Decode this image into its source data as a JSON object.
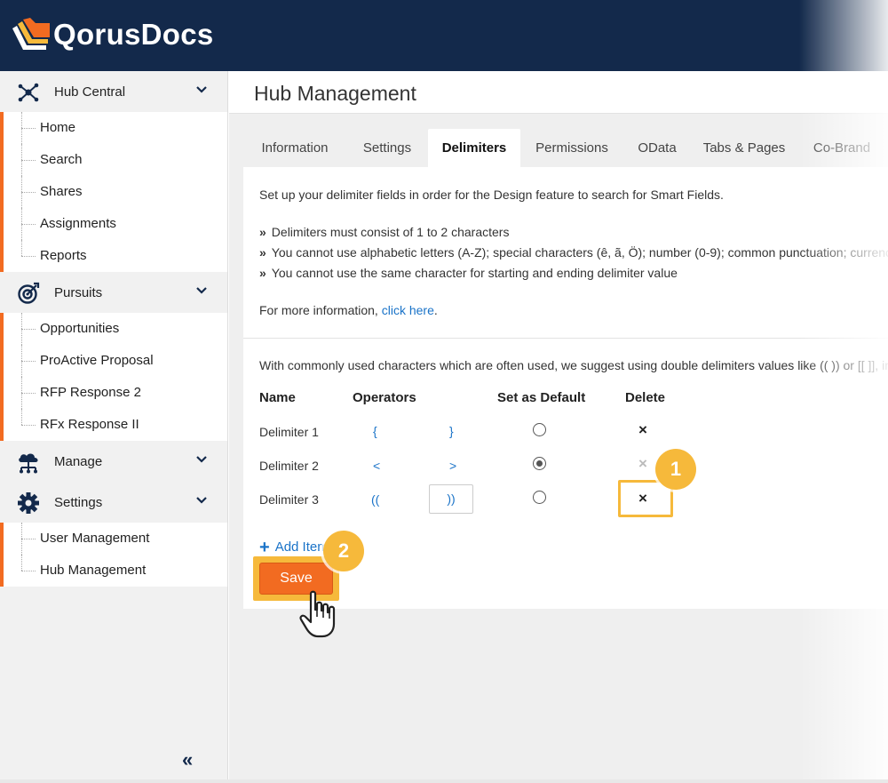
{
  "brand": {
    "name": "QorusDocs",
    "accent": "#f26b21",
    "header_bg": "#13294b",
    "callout": "#f6b93b"
  },
  "sidebar": {
    "groups": [
      {
        "label": "Hub Central",
        "icon": "hub-icon",
        "items": [
          "Home",
          "Search",
          "Shares",
          "Assignments",
          "Reports"
        ]
      },
      {
        "label": "Pursuits",
        "icon": "target-icon",
        "items": [
          "Opportunities",
          "ProActive Proposal",
          "RFP Response 2",
          "RFx Response II"
        ]
      },
      {
        "label": "Manage",
        "icon": "cloud-network-icon",
        "items": []
      },
      {
        "label": "Settings",
        "icon": "gear-icon",
        "items": [
          "User Management",
          "Hub Management"
        ]
      }
    ],
    "collapse_glyph": "«"
  },
  "page": {
    "title": "Hub Management"
  },
  "tabs": [
    {
      "label": "Information"
    },
    {
      "label": "Settings"
    },
    {
      "label": "Delimiters",
      "active": true
    },
    {
      "label": "Permissions"
    },
    {
      "label": "OData"
    },
    {
      "label": "Tabs & Pages"
    },
    {
      "label": "Co-Brand"
    }
  ],
  "content": {
    "intro": "Set up your delimiter fields in order for the Design feature to search for Smart Fields.",
    "bullets": [
      "Delimiters must consist of 1 to 2 characters",
      "You cannot use alphabetic letters (A-Z); special characters (ê, ã, Ö); number (0-9); common punctuation; currenc",
      "You cannot use the same character for starting and ending delimiter value"
    ],
    "more_prefix": "For more information, ",
    "more_link": "click here",
    "more_suffix": ".",
    "suggest": "With commonly used characters which are often used, we suggest using double delimiters values like (( )) or [[ ]], in"
  },
  "table": {
    "headers": {
      "name": "Name",
      "operators": "Operators",
      "default": "Set as Default",
      "delete": "Delete"
    },
    "rows": [
      {
        "name": "Delimiter 1",
        "start": "{",
        "end": "}",
        "default": false,
        "delete": "×"
      },
      {
        "name": "Delimiter 2",
        "start": "<",
        "end": ">",
        "default": true,
        "delete": "×"
      },
      {
        "name": "Delimiter 3",
        "start": "((",
        "end": "))",
        "default": false,
        "delete": "×"
      }
    ]
  },
  "actions": {
    "add_item": "Add Item",
    "save": "Save"
  },
  "callouts": {
    "one": "1",
    "two": "2"
  }
}
